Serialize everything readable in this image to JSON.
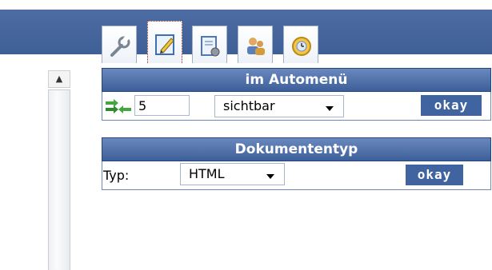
{
  "tabs": [
    {
      "icon": "wrench-icon",
      "active": false
    },
    {
      "icon": "pencil-icon",
      "active": true
    },
    {
      "icon": "document-settings-icon",
      "active": false
    },
    {
      "icon": "users-icon",
      "active": false
    },
    {
      "icon": "clock-refresh-icon",
      "active": false
    }
  ],
  "automenu": {
    "header": "im Automenü",
    "position_value": "5",
    "visibility_selected": "sichtbar",
    "okay_label": "okay"
  },
  "doctype": {
    "header": "Dokumententyp",
    "type_label": "Typ:",
    "type_selected": "HTML",
    "okay_label": "okay"
  },
  "colors": {
    "header_blue": "#3d5f99",
    "topbar_blue": "#4d6ca3",
    "okay_button": "#3f64a0"
  }
}
